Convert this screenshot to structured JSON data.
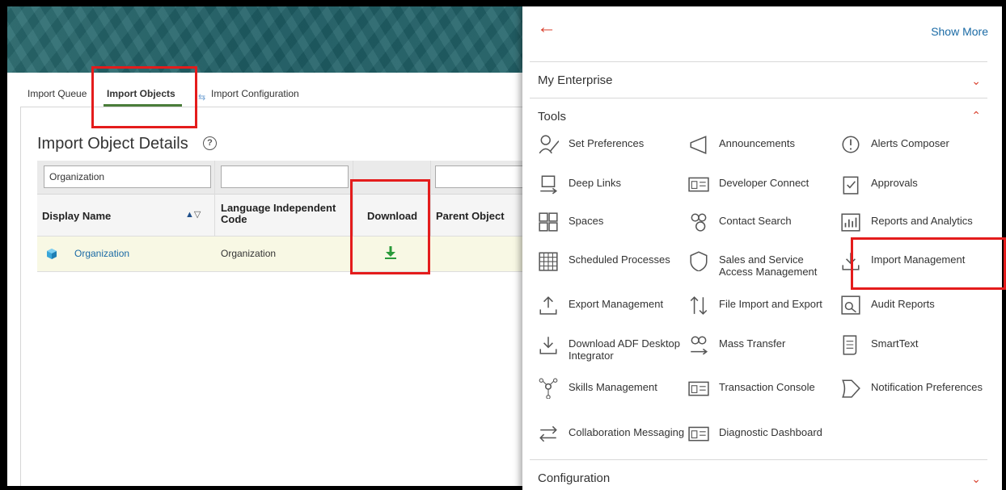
{
  "tabs": {
    "queue": "Import Queue",
    "objects": "Import Objects",
    "config": "Import Configuration"
  },
  "page": {
    "title": "Import Object Details",
    "help": "?"
  },
  "table": {
    "filter_display_name": "Organization",
    "headers": {
      "display_name": "Display Name",
      "language_code": "Language Independent Code",
      "download": "Download",
      "parent_object": "Parent Object"
    },
    "row": {
      "display_name": "Organization",
      "language_code": "Organization"
    }
  },
  "panel": {
    "show_more": "Show More",
    "sections": {
      "my_enterprise": "My Enterprise",
      "tools": "Tools",
      "configuration": "Configuration"
    },
    "tools": [
      "Set Preferences",
      "Announcements",
      "Alerts Composer",
      "Deep Links",
      "Developer Connect",
      "Approvals",
      "Spaces",
      "Contact Search",
      "Reports and Analytics",
      "Scheduled Processes",
      "Sales and Service Access Management",
      "Import Management",
      "Export Management",
      "File Import and Export",
      "Audit Reports",
      "Download ADF Desktop Integrator",
      "Mass Transfer",
      "SmartText",
      "Skills Management",
      "Transaction Console",
      "Notification Preferences",
      "Collaboration Messaging",
      "Diagnostic Dashboard"
    ]
  },
  "colors": {
    "accent_red": "#d9412e",
    "link_blue": "#1a6aa5",
    "highlight_red": "#e41c1c",
    "download_green": "#2a9a3a"
  }
}
